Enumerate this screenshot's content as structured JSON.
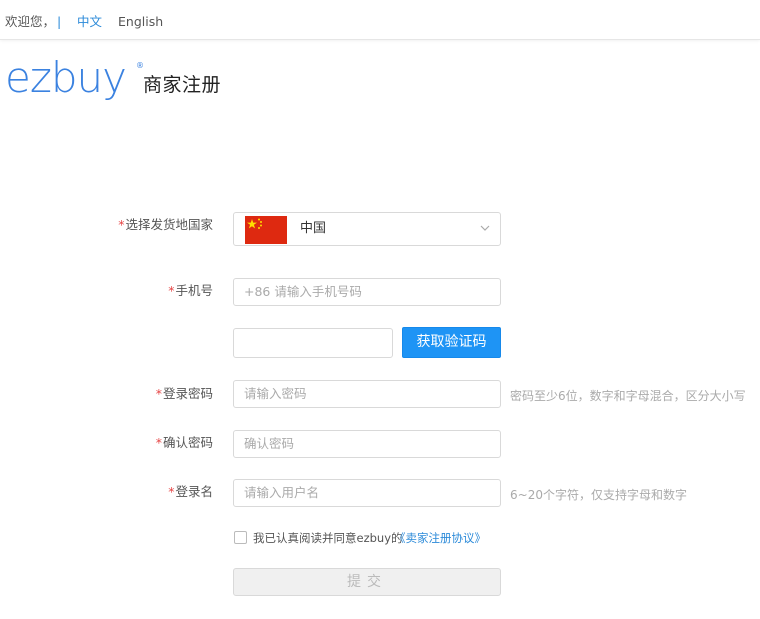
{
  "header": {
    "welcome": "欢迎您，",
    "separator": "|",
    "lang_zh": "中文",
    "lang_en": "English"
  },
  "brand": {
    "logo_text": "ezbuy",
    "logo_mark": "®",
    "page_title": "商家注册",
    "color": "#3b82e0"
  },
  "form": {
    "required_mark": "*",
    "country": {
      "label": "选择发货地国家",
      "value": "中国",
      "flag_icon": "china-flag-icon"
    },
    "phone": {
      "label": "手机号",
      "placeholder": "+86 请输入手机号码"
    },
    "verify": {
      "value": "",
      "button_label": "获取验证码"
    },
    "password": {
      "label": "登录密码",
      "placeholder": "请输入密码",
      "hint": "密码至少6位，数字和字母混合，区分大小写"
    },
    "confirm": {
      "label": "确认密码",
      "placeholder": "确认密码"
    },
    "username": {
      "label": "登录名",
      "placeholder": "请输入用户名",
      "hint": "6~20个字符，仅支持字母和数字"
    },
    "agreement": {
      "checked": false,
      "text": "我已认真阅读并同意ezbuy的",
      "link": "《卖家注册协议》"
    },
    "submit_label": "提交"
  },
  "colors": {
    "accent": "#1e94f5",
    "link": "#2b8ad9",
    "required": "#e64545"
  }
}
